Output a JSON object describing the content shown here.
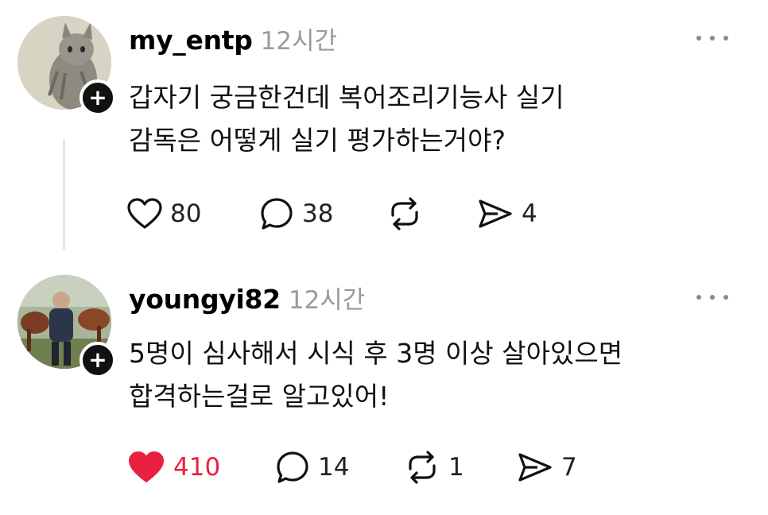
{
  "posts": [
    {
      "username": "my_entp",
      "time": "12시간",
      "avatar_icon": "cat-avatar",
      "text_lines": [
        "갑자기 궁금한건데 복어조리기능사 실기",
        "감독은 어떻게 실기 평가하는거야?"
      ],
      "likes": "80",
      "comments": "38",
      "reposts": "",
      "shares": "4",
      "liked": false
    },
    {
      "username": "youngyi82",
      "time": "12시간",
      "avatar_icon": "horses-avatar",
      "text_lines": [
        "5명이 심사해서 시식 후 3명 이상 살아있으면",
        "합격하는걸로 알고있어!"
      ],
      "likes": "410",
      "comments": "14",
      "reposts": "1",
      "shares": "7",
      "liked": true
    }
  ],
  "follow_badge": "+",
  "colors": {
    "liked": "#e8213e",
    "muted": "#9a9a9a",
    "text": "#111111"
  },
  "icons": [
    "heart-icon",
    "comment-icon",
    "repost-icon",
    "share-icon",
    "more-icon",
    "plus-icon"
  ]
}
